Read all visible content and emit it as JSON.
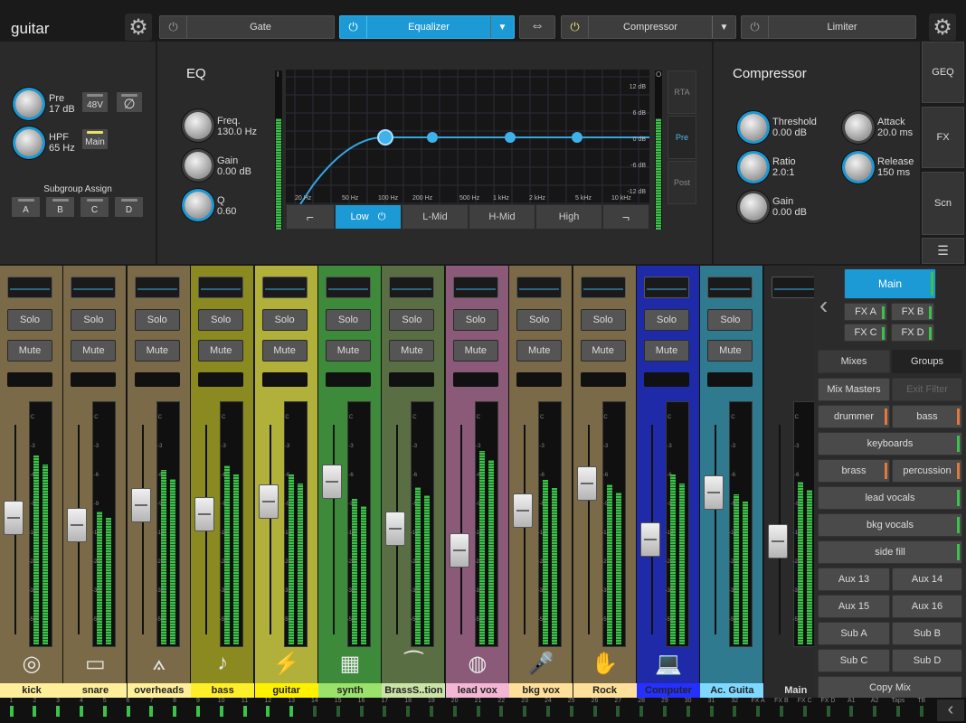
{
  "header": {
    "channel_name": "guitar",
    "fx": {
      "gate": "Gate",
      "equalizer": "Equalizer",
      "compressor": "Compressor",
      "limiter": "Limiter"
    }
  },
  "input": {
    "pre_label": "Pre",
    "pre_value": "17 dB",
    "hpf_label": "HPF",
    "hpf_value": "65 Hz",
    "phantom": "48V",
    "phase": "∅",
    "main": "Main",
    "subgroup_title": "Subgroup Assign",
    "subgroups": [
      "A",
      "B",
      "C",
      "D"
    ]
  },
  "eq": {
    "title": "EQ",
    "freq_label": "Freq.",
    "freq_value": "130.0 Hz",
    "gain_label": "Gain",
    "gain_value": "0.00 dB",
    "q_label": "Q",
    "q_value": "0.60",
    "db_ticks": [
      "12 dB",
      "6 dB",
      "0 dB",
      "-6 dB",
      "-12 dB"
    ],
    "freq_ticks": [
      "20 Hz",
      "50 Hz",
      "100 Hz",
      "200 Hz",
      "500 Hz",
      "1 kHz",
      "2 kHz",
      "5 kHz",
      "10 kHz"
    ],
    "bands": [
      "Low",
      "L-Mid",
      "H-Mid",
      "High"
    ],
    "modes": [
      "RTA",
      "Pre",
      "Post"
    ],
    "meter_top": "I",
    "meter_top_r": "O"
  },
  "compressor": {
    "title": "Compressor",
    "threshold_label": "Threshold",
    "threshold_value": "0.00 dB",
    "ratio_label": "Ratio",
    "ratio_value": "2.0:1",
    "gain_label": "Gain",
    "gain_value": "0.00 dB",
    "attack_label": "Attack",
    "attack_value": "20.0 ms",
    "release_label": "Release",
    "release_value": "150 ms"
  },
  "side": {
    "geq": "GEQ",
    "fx": "FX",
    "scn": "Scn"
  },
  "strip_labels": {
    "solo": "Solo",
    "mute": "Mute"
  },
  "meter_scale": [
    "C",
    "-3",
    "-6",
    "-9",
    "-12",
    "-20",
    "-30",
    "-50"
  ],
  "channels": [
    {
      "name": "kick",
      "color": "#7a6a48",
      "label_bg": "#ffef9a",
      "icon": "◎",
      "fader": 0.42,
      "level": 0.78
    },
    {
      "name": "snare",
      "color": "#7a6a48",
      "label_bg": "#ffef9a",
      "icon": "▭",
      "fader": 0.46,
      "level": 0.55
    },
    {
      "name": "overheads",
      "color": "#7a6a48",
      "label_bg": "#ffef9a",
      "icon": "⟑",
      "fader": 0.35,
      "level": 0.72
    },
    {
      "name": "bass",
      "color": "#8a8a20",
      "label_bg": "#ffef2a",
      "icon": "♪",
      "fader": 0.4,
      "level": 0.74
    },
    {
      "name": "guitar",
      "color": "#b1b03a",
      "label_bg": "#fff200",
      "icon": "⚡",
      "fader": 0.33,
      "level": 0.7
    },
    {
      "name": "synth",
      "color": "#3c8a3a",
      "label_bg": "#9be26a",
      "icon": "▦",
      "fader": 0.22,
      "level": 0.6
    },
    {
      "name": "BrassS..tion",
      "color": "#5a6e44",
      "label_bg": "#cbe3a7",
      "icon": "⁀",
      "fader": 0.48,
      "level": 0.65
    },
    {
      "name": "lead vox",
      "color": "#8a5a78",
      "label_bg": "#f3b6d4",
      "icon": "◍",
      "fader": 0.6,
      "level": 0.8
    },
    {
      "name": "bkg vox",
      "color": "#7a6a48",
      "label_bg": "#ffe09a",
      "icon": "🎤",
      "fader": 0.38,
      "level": 0.68
    },
    {
      "name": "Rock",
      "color": "#7a6a48",
      "label_bg": "#ffe09a",
      "icon": "✋",
      "fader": 0.23,
      "level": 0.66
    },
    {
      "name": "Computer",
      "color": "#1f2aa8",
      "label_bg": "#2530ff",
      "icon": "💻",
      "fader": 0.54,
      "level": 0.7
    },
    {
      "name": "Ac. Guita",
      "color": "#2f7a8e",
      "label_bg": "#7fd8ff",
      "icon": "",
      "fader": 0.28,
      "level": 0.62
    },
    {
      "name": "Main",
      "color": "#2a2a2a",
      "label_bg": "#2a2a2a",
      "icon": "",
      "fader": 0.55,
      "level": 0.67
    }
  ],
  "mixes": {
    "main": "Main",
    "fx": [
      "FX A",
      "FX B",
      "FX C",
      "FX D"
    ],
    "tabs": [
      "Mixes",
      "Groups"
    ],
    "mix_masters": "Mix Masters",
    "exit_filter": "Exit Filter",
    "rows": [
      [
        "drummer",
        "bass"
      ],
      [
        "keyboards"
      ],
      [
        "brass",
        "percussion"
      ],
      [
        "lead vocals"
      ],
      [
        "bkg vocals"
      ],
      [
        "side fill"
      ],
      [
        "Aux 13",
        "Aux 14"
      ],
      [
        "Aux 15",
        "Aux 16"
      ],
      [
        "Sub A",
        "Sub B"
      ],
      [
        "Sub C",
        "Sub D"
      ],
      [
        "Copy Mix"
      ]
    ]
  },
  "bottom": [
    "1",
    "2",
    "3",
    "4",
    "5",
    "6",
    "7",
    "8",
    "9",
    "10",
    "11",
    "12",
    "13",
    "14",
    "15",
    "16",
    "17",
    "18",
    "19",
    "20",
    "21",
    "22",
    "23",
    "24",
    "25",
    "26",
    "27",
    "28",
    "29",
    "30",
    "31",
    "32",
    "FX A",
    "FX B",
    "FX C",
    "FX D",
    "A1",
    "A2",
    "Taps",
    "TB"
  ]
}
